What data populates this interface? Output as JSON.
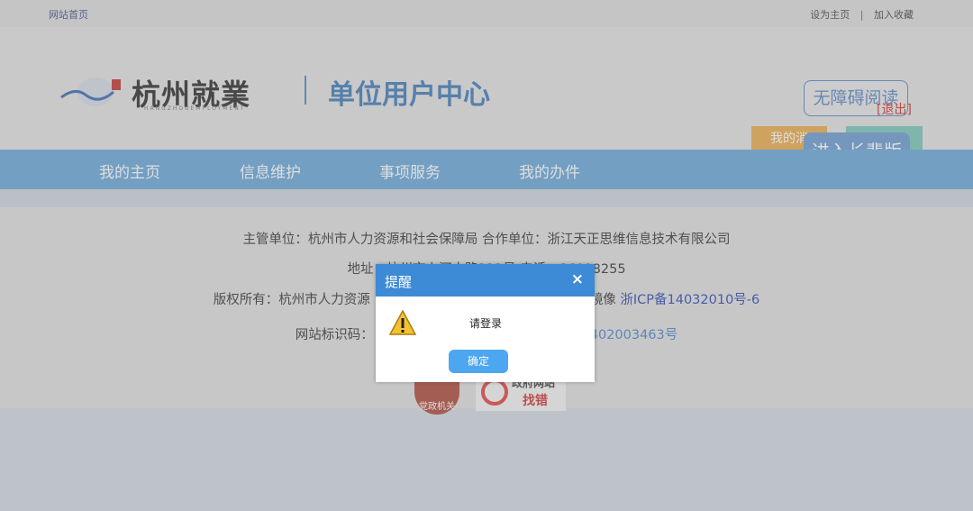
{
  "topbar": {
    "home": "网站首页",
    "set_home": "设为主页",
    "separator": "|",
    "favorite": "加入收藏"
  },
  "header": {
    "logo_text": "杭州就業",
    "logo_sub": "HANGZHOUEMPLOYMENT",
    "center_title": "单位用户中心",
    "accessibility": "无障碍阅读",
    "logout": "[退出]",
    "my_messages": "我的消",
    "elder_mode": "进入长辈版"
  },
  "nav": {
    "items": [
      "我的主页",
      "信息维护",
      "事项服务",
      "我的办件"
    ]
  },
  "footer": {
    "line1": "主管单位：杭州市人力资源和社会保障局 合作单位：浙江天正思维信息技术有限公司",
    "line2": "地址：杭州市上河中路222号 电话：86998255",
    "line3_prefix": "版权所有：杭州市人力资源",
    "line3_mid": "镜像",
    "line3_icp": "浙ICP备14032010号-6",
    "line4_prefix": "网站标识码：",
    "line4_code": "402003463号",
    "badge1": "党政机关",
    "badge2_top": "政府网站",
    "badge2_bottom": "找错"
  },
  "dialog": {
    "title": "提醒",
    "close": "×",
    "message": "请登录",
    "ok": "确定"
  },
  "colors": {
    "nav": "#5b9fd6",
    "title": "#2f6fb2",
    "dialog_header": "#3d8ad6",
    "ok_button": "#4da6f0"
  }
}
